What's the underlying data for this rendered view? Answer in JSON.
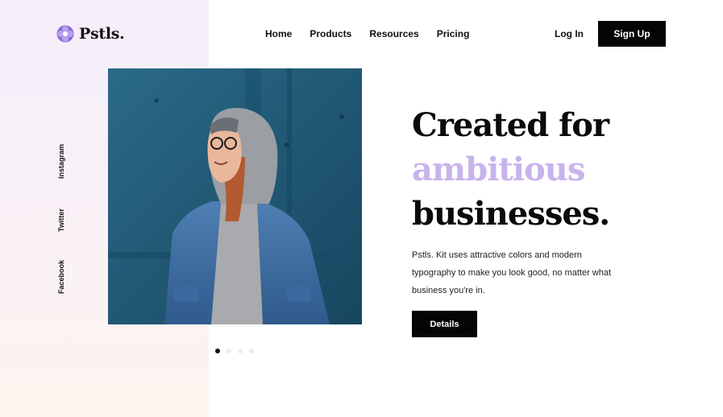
{
  "brand": {
    "name": "Pstls.",
    "icon": "pastel-flower-logo-icon",
    "accent_color": "#c7b4ec"
  },
  "nav": {
    "items": [
      {
        "label": "Home"
      },
      {
        "label": "Products"
      },
      {
        "label": "Resources"
      },
      {
        "label": "Pricing"
      }
    ],
    "login_label": "Log In",
    "signup_label": "Sign Up"
  },
  "social": {
    "items": [
      {
        "label": "Instagram"
      },
      {
        "label": "Twitter"
      },
      {
        "label": "Facebook"
      }
    ]
  },
  "hero": {
    "headline_line1": "Created for",
    "headline_accent": "ambitious",
    "headline_line3": "businesses.",
    "description": "Pstls. Kit uses attractive colors and modern typography to make you look good, no matter what business you're in.",
    "cta_label": "Details",
    "image_alt": "photo-of-person-in-hoodie-and-denim-jacket"
  },
  "carousel": {
    "count": 4,
    "active_index": 0
  },
  "colors": {
    "dark": "#050505",
    "accent": "#c7b4ec",
    "image_bg": "#1f5875"
  }
}
